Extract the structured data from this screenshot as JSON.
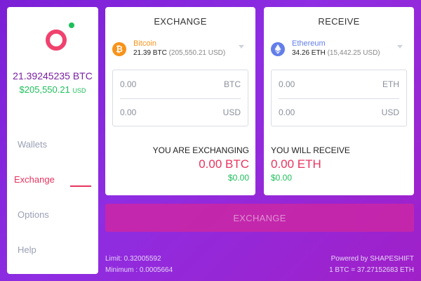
{
  "wallet": {
    "balance_btc": "21.39245235 BTC",
    "balance_usd": "$205,550.21",
    "balance_usd_unit": "USD"
  },
  "nav": {
    "items": [
      {
        "label": "Wallets"
      },
      {
        "label": "Exchange"
      },
      {
        "label": "Options"
      },
      {
        "label": "Help"
      }
    ],
    "active": "Exchange"
  },
  "exchange": {
    "title": "EXCHANGE",
    "coin": {
      "name": "Bitcoin",
      "amount": "21.39 BTC",
      "usd": "(205,550.21 USD)",
      "icon": "bitcoin-icon"
    },
    "input_amount": "0.00",
    "input_unit": "BTC",
    "input_usd": "0.00",
    "input_usd_unit": "USD",
    "summary_label": "YOU ARE EXCHANGING",
    "summary_amount": "0.00 BTC",
    "summary_usd": "$0.00"
  },
  "receive": {
    "title": "RECEIVE",
    "coin": {
      "name": "Ethereum",
      "amount": "34.26 ETH",
      "usd": "(15,442.25 USD)",
      "icon": "ethereum-icon"
    },
    "input_amount": "0.00",
    "input_unit": "ETH",
    "input_usd": "0.00",
    "input_usd_unit": "USD",
    "summary_label": "YOU WILL RECEIVE",
    "summary_amount": "0.00 ETH",
    "summary_usd": "$0.00"
  },
  "action": {
    "exchange_label": "EXCHANGE"
  },
  "footer": {
    "limit": "Limit: 0.32005592",
    "minimum": "Minimum : 0.0005664",
    "powered": "Powered by SHAPESHIFT",
    "rate": "1 BTC = 37.27152683 ETH"
  },
  "colors": {
    "accent": "#e8345f",
    "positive": "#1dbf5a",
    "brand_purple": "#7b1fa2",
    "bitcoin": "#f7931a",
    "ethereum": "#627eea",
    "button": "#c727a8"
  }
}
